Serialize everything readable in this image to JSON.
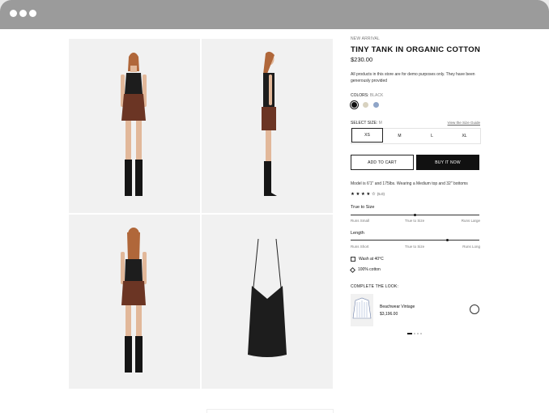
{
  "product": {
    "eyebrow": "NEW ARRIVAL",
    "title": "TINY TANK IN ORGANIC COTTON",
    "price": "$230.00",
    "note": "All products in this store are for demo purposes only. They have been generously provided"
  },
  "colors": {
    "label": "COLORS:",
    "selected": "BLACK",
    "swatches": [
      {
        "name": "black",
        "hex": "#111111"
      },
      {
        "name": "beige",
        "hex": "#d8d2c0"
      },
      {
        "name": "blue",
        "hex": "#8fa5c8"
      }
    ]
  },
  "size": {
    "label": "SELECT SIZE:",
    "selected": "M",
    "guide": "View the Size Guide",
    "options": [
      "XS",
      "M",
      "L",
      "XL"
    ]
  },
  "actions": {
    "add_to_cart": "ADD TO CART",
    "buy_now": "BUY IT NOW"
  },
  "model_info": "Model is 6'1\" and 175lbs. Wearing a Medium top and 32\" bottoms",
  "rating": {
    "stars": "★ ★ ★ ★ ☆",
    "count": "(5.0)",
    "value": 4
  },
  "fit": [
    {
      "label": "True to Size",
      "low": "Runs Small",
      "mid": "True to Size",
      "high": "Runs Large",
      "level": 0.5
    },
    {
      "label": "Length",
      "low": "Runs Short",
      "mid": "True to Size",
      "high": "Runs Long",
      "level": 0.75
    }
  ],
  "care": [
    {
      "icon": "wash-icon",
      "text": "Wash at 40°C"
    },
    {
      "icon": "layers-icon",
      "text": "100% cotton"
    }
  ],
  "look": {
    "heading": "COMPLETE THE LOOK:",
    "item_name": "Beachwear Vintage",
    "item_price": "$3,196.00"
  }
}
